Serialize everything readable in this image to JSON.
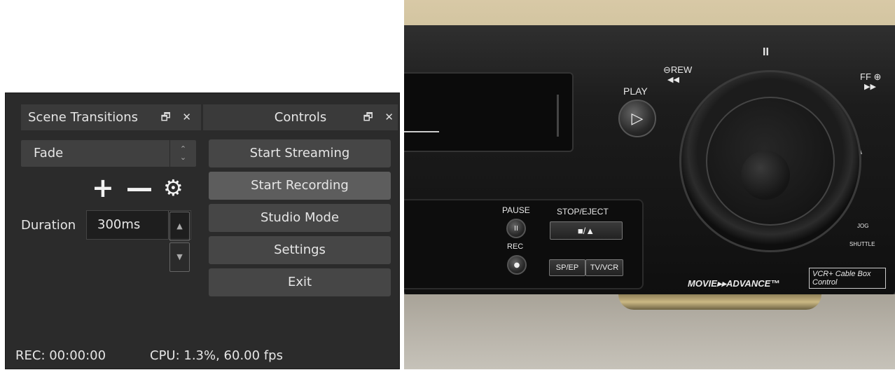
{
  "obs": {
    "scene_transitions": {
      "title": "Scene Transitions",
      "dock_buttons": "🗗 ✕",
      "transition_select": "Fade",
      "select_arrows": "⌃\n⌄",
      "add_icon": "+",
      "remove_icon": "—",
      "gear_icon": "⚙",
      "duration_label": "Duration",
      "duration_value": "300ms"
    },
    "controls": {
      "title": "Controls",
      "dock_buttons": "🗗 ✕",
      "buttons": {
        "start_streaming": "Start Streaming",
        "start_recording": "Start Recording",
        "studio_mode": "Studio Mode",
        "settings": "Settings",
        "exit": "Exit"
      }
    },
    "status_bar": {
      "rec": "REC: 00:00:00",
      "cpu": "CPU: 1.3%, 60.00 fps"
    }
  },
  "vcr_photo": {
    "labels": {
      "play": "PLAY",
      "rew": "⊖REW",
      "rew_arrows": "◀◀",
      "pause_symbol": "II",
      "ff": "FF ⊕",
      "ff_arrows": "▶▶",
      "pause": "PAUSE",
      "stop_eject": "STOP/EJECT",
      "stop_eject_symbol": "■/▲",
      "rec": "REC",
      "sp_ep": "SP/EP",
      "tv_vcr": "TV/VCR",
      "jog": "JOG",
      "shuttle": "SHUTTLE",
      "movie_advance": "MOVIE▸▸ADVANCE™",
      "vcr_plus": "VCR+ Cable Box Control"
    }
  }
}
